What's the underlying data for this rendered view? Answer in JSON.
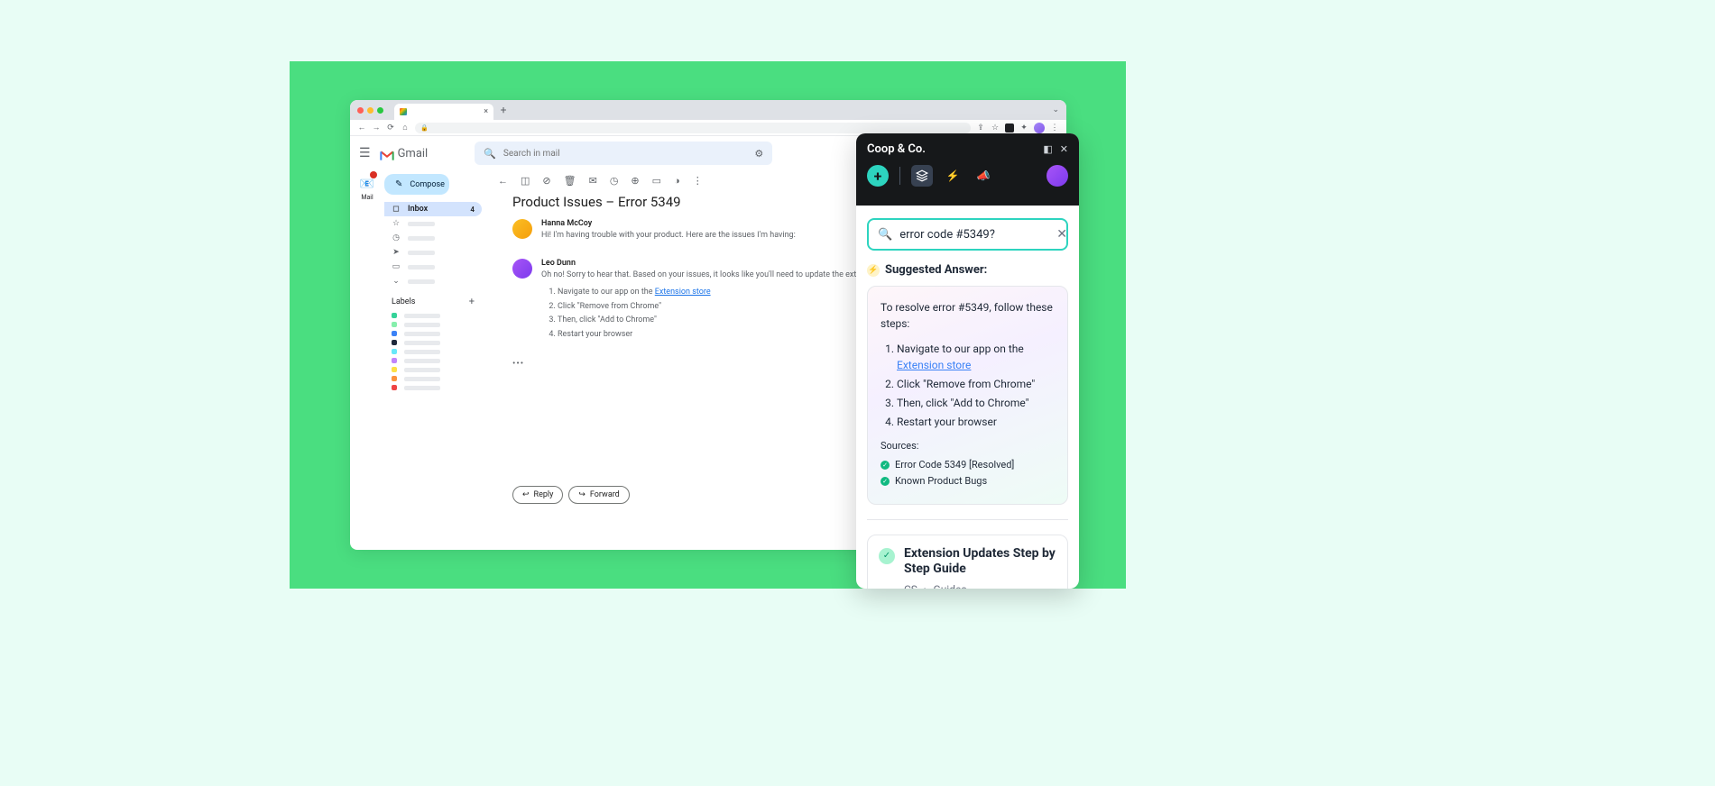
{
  "browser": {
    "tab_title": "",
    "newtab": "+",
    "nav": {
      "back": "←",
      "fwd": "→",
      "reload": "⟳",
      "home": "⌂"
    }
  },
  "gmail": {
    "app_name": "Gmail",
    "search_placeholder": "Search in mail",
    "rail": {
      "mail_label": "Mail",
      "badge": ""
    },
    "compose": "Compose",
    "nav": {
      "inbox": "Inbox",
      "inbox_count": "4"
    },
    "labels_header": "Labels",
    "subject": "Product Issues – Error 5349",
    "messages": [
      {
        "sender": "Hanna McCoy",
        "text": "Hi! I'm having trouble with your product. Here are the issues I'm having:"
      },
      {
        "sender": "Leo Dunn",
        "text": "Oh no! Sorry to hear that. Based on your issues, it looks like you'll need to update the extension. Here are instructions on how to do that:",
        "step1_pre": "Navigate to our app on the ",
        "step1_link": "Extension store",
        "step2": "Click \"Remove from Chrome\"",
        "step3": "Then, click \"Add to Chrome\"",
        "step4": "Restart your browser"
      }
    ],
    "reply": "Reply",
    "forward": "Forward"
  },
  "coop": {
    "title": "Coop & Co.",
    "search_value": "error code #5349?",
    "suggested_label": "Suggested Answer:",
    "answer_intro": "To resolve error #5349, follow these steps:",
    "steps": {
      "s1_pre": "Navigate to our app on the ",
      "s1_link": "Extension store",
      "s2": "Click \"Remove from Chrome\"",
      "s3": "Then, click \"Add to Chrome\"",
      "s4": "Restart your browser"
    },
    "sources_label": "Sources:",
    "sources": [
      "Error Code 5349 [Resolved]",
      "Known Product Bugs"
    ],
    "guide": {
      "title": "Extension Updates Step by Step Guide",
      "bc_1": "CS",
      "bc_sep": "›",
      "bc_2": "Guides"
    }
  },
  "label_colors": [
    "#34d399",
    "#86efac",
    "#3b82f6",
    "#1e293b",
    "#67e8f9",
    "#c084fc",
    "#fde047",
    "#fb923c",
    "#ef4444"
  ]
}
